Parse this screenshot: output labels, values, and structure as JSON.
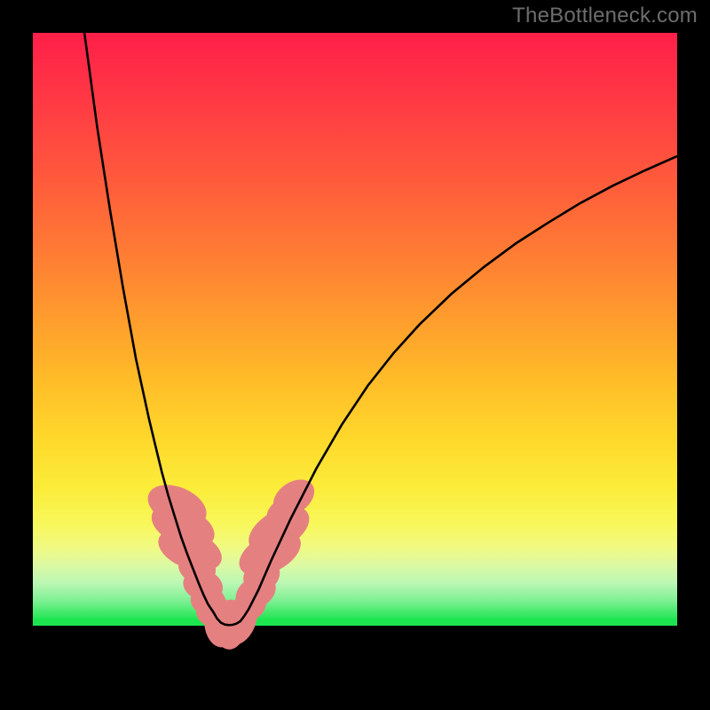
{
  "watermark": {
    "text": "TheBottleneck.com"
  },
  "gradient": {
    "stops": [
      {
        "offset": 0.0,
        "color": "#ff1f49"
      },
      {
        "offset": 0.12,
        "color": "#ff3a44"
      },
      {
        "offset": 0.25,
        "color": "#ff5a3c"
      },
      {
        "offset": 0.38,
        "color": "#ff7d34"
      },
      {
        "offset": 0.5,
        "color": "#ffa02c"
      },
      {
        "offset": 0.6,
        "color": "#ffbe28"
      },
      {
        "offset": 0.7,
        "color": "#ffda2c"
      },
      {
        "offset": 0.78,
        "color": "#fbed3b"
      },
      {
        "offset": 0.84,
        "color": "#f8f85c"
      },
      {
        "offset": 0.88,
        "color": "#f0fa84"
      },
      {
        "offset": 0.91,
        "color": "#dbf9a4"
      },
      {
        "offset": 0.94,
        "color": "#b9f7b4"
      },
      {
        "offset": 0.97,
        "color": "#7df092"
      },
      {
        "offset": 1.0,
        "color": "#24e655"
      }
    ]
  },
  "chart_data": {
    "type": "line",
    "title": "",
    "xlabel": "",
    "ylabel": "",
    "xlim": [
      0,
      100
    ],
    "ylim": [
      0,
      100
    ],
    "series": [
      {
        "name": "curve-left",
        "x": [
          8.0,
          10.0,
          12.0,
          14.0,
          16.0,
          18.0,
          19.0,
          20.0,
          21.0,
          22.0,
          23.0,
          24.0,
          25.0,
          25.8,
          26.5,
          27.2,
          28.0
        ],
        "values": [
          100.0,
          84.0,
          70.0,
          57.0,
          45.0,
          35.0,
          30.5,
          26.0,
          22.0,
          18.5,
          15.0,
          12.0,
          9.2,
          7.0,
          5.2,
          3.6,
          2.3
        ]
      },
      {
        "name": "curve-valley",
        "x": [
          28.0,
          28.6,
          29.2,
          29.8,
          30.4,
          31.0,
          31.6,
          32.2,
          32.8,
          33.5
        ],
        "values": [
          2.3,
          1.2,
          0.5,
          0.2,
          0.1,
          0.15,
          0.35,
          0.75,
          1.6,
          2.8
        ]
      },
      {
        "name": "curve-right",
        "x": [
          33.5,
          35.0,
          37.0,
          40.0,
          44.0,
          48.0,
          52.0,
          56.0,
          60.0,
          65.0,
          70.0,
          75.0,
          80.0,
          85.0,
          90.0,
          95.0,
          100.0
        ],
        "values": [
          2.8,
          6.0,
          11.0,
          18.0,
          26.5,
          34.0,
          40.5,
          46.0,
          50.8,
          56.0,
          60.5,
          64.5,
          68.0,
          71.3,
          74.2,
          76.8,
          79.2
        ]
      }
    ],
    "nodules": {
      "name": "nodules",
      "color": "#e58080",
      "points": [
        {
          "x": 22.4,
          "y": 20.2,
          "rx": 2.9,
          "ry": 5.2,
          "rot": -67
        },
        {
          "x": 23.3,
          "y": 16.8,
          "rx": 2.9,
          "ry": 5.6,
          "rot": -67
        },
        {
          "x": 24.4,
          "y": 12.8,
          "rx": 2.9,
          "ry": 5.6,
          "rot": -69
        },
        {
          "x": 25.5,
          "y": 9.7,
          "rx": 2.3,
          "ry": 3.2,
          "rot": -72
        },
        {
          "x": 26.4,
          "y": 6.8,
          "rx": 2.4,
          "ry": 3.4,
          "rot": -73
        },
        {
          "x": 27.2,
          "y": 4.2,
          "rx": 2.3,
          "ry": 3.0,
          "rot": -75
        },
        {
          "x": 27.9,
          "y": 2.2,
          "rx": 2.2,
          "ry": 2.8,
          "rot": -76
        },
        {
          "x": 29.1,
          "y": 0.55,
          "rx": 2.5,
          "ry": 4.2,
          "rot": -4
        },
        {
          "x": 30.6,
          "y": 0.2,
          "rx": 2.5,
          "ry": 4.2,
          "rot": 3
        },
        {
          "x": 32.1,
          "y": 0.8,
          "rx": 2.5,
          "ry": 4.2,
          "rot": 22
        },
        {
          "x": 33.6,
          "y": 3.4,
          "rx": 2.3,
          "ry": 3.0,
          "rot": 56
        },
        {
          "x": 34.6,
          "y": 5.6,
          "rx": 2.4,
          "ry": 3.6,
          "rot": 60
        },
        {
          "x": 35.5,
          "y": 8.4,
          "rx": 2.4,
          "ry": 3.2,
          "rot": 62
        },
        {
          "x": 36.8,
          "y": 12.2,
          "rx": 2.9,
          "ry": 5.6,
          "rot": 63
        },
        {
          "x": 38.2,
          "y": 16.2,
          "rx": 2.9,
          "ry": 5.6,
          "rot": 60
        },
        {
          "x": 39.2,
          "y": 18.9,
          "rx": 2.4,
          "ry": 3.4,
          "rot": 58
        },
        {
          "x": 40.5,
          "y": 21.6,
          "rx": 2.4,
          "ry": 3.8,
          "rot": 55
        }
      ]
    }
  }
}
